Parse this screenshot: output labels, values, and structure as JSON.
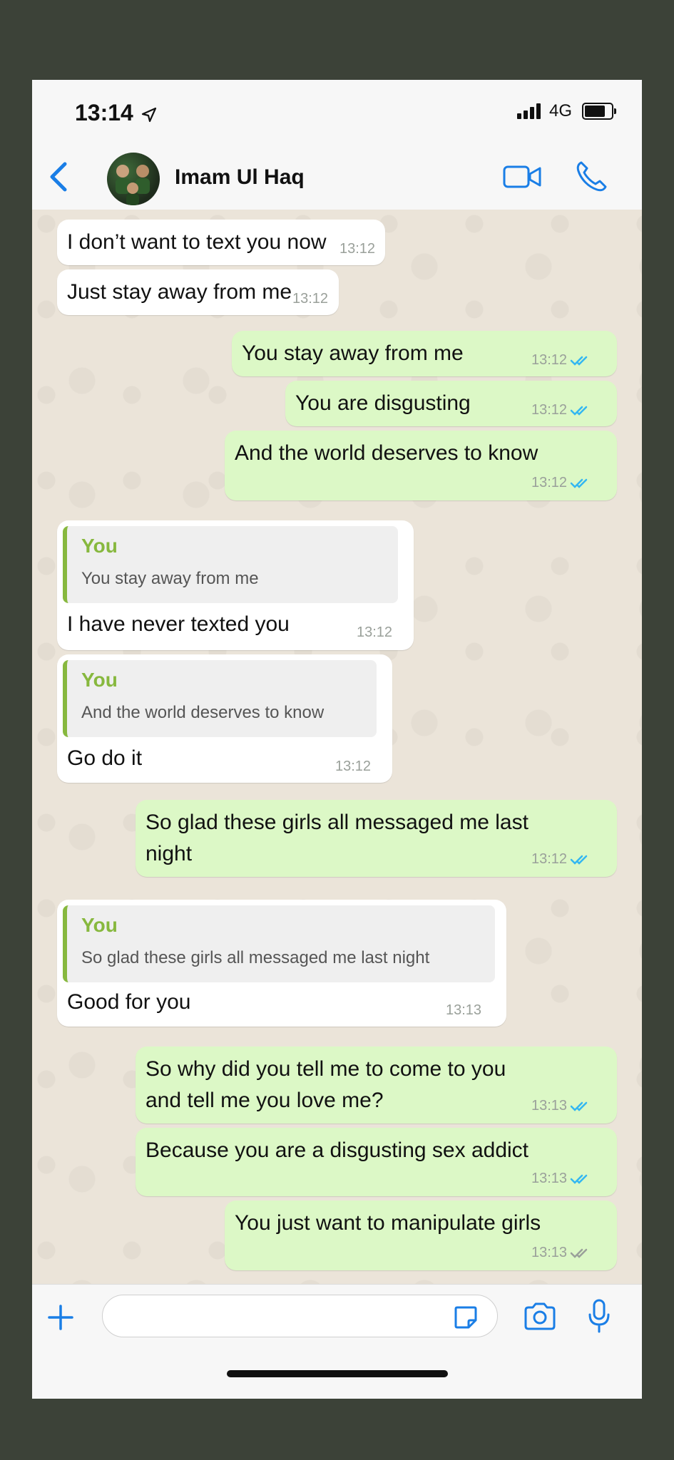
{
  "status_bar": {
    "time": "13:14",
    "network": "4G"
  },
  "header": {
    "contact_name": "Imam Ul Haq"
  },
  "messages": [
    {
      "dir": "in",
      "text": "I don’t want to text you now",
      "time": "13:12"
    },
    {
      "dir": "in",
      "text": "Just stay away from me",
      "time": "13:12"
    },
    {
      "dir": "out",
      "text": "You stay away from me",
      "time": "13:12"
    },
    {
      "dir": "out",
      "text": "You are disgusting",
      "time": "13:12"
    },
    {
      "dir": "out",
      "text": "And the world deserves to know",
      "time": "13:12"
    },
    {
      "dir": "in",
      "quote_author": "You",
      "quote_text": "You stay away from me",
      "text": "I have never texted you",
      "time": "13:12"
    },
    {
      "dir": "in",
      "quote_author": "You",
      "quote_text": "And the world deserves to know",
      "text": "Go do it",
      "time": "13:12"
    },
    {
      "dir": "out",
      "text_line1": "So glad these girls all messaged me last",
      "text_line2": "night",
      "time": "13:12"
    },
    {
      "dir": "in",
      "quote_author": "You",
      "quote_text": "So glad these girls all messaged me last night",
      "text": "Good for you",
      "time": "13:13"
    },
    {
      "dir": "out",
      "text_line1": "So why did you tell me to come to you",
      "text_line2": "and tell me you love me?",
      "time": "13:13"
    },
    {
      "dir": "out",
      "text": "Because you are a disgusting sex addict",
      "time": "13:13"
    },
    {
      "dir": "out",
      "text": "You just want to manipulate girls",
      "time": "13:13"
    }
  ],
  "input": {
    "placeholder": ""
  },
  "colors": {
    "outgoing_bubble": "#dcf8c6",
    "incoming_bubble": "#ffffff",
    "accent": "#1a7ee6",
    "quote_bar": "#87b83e",
    "read_ticks": "#34b7f1"
  },
  "icons": [
    "back-chevron-icon",
    "video-call-icon",
    "phone-call-icon",
    "plus-icon",
    "sticker-icon",
    "camera-icon",
    "microphone-icon",
    "read-receipt-icon"
  ]
}
